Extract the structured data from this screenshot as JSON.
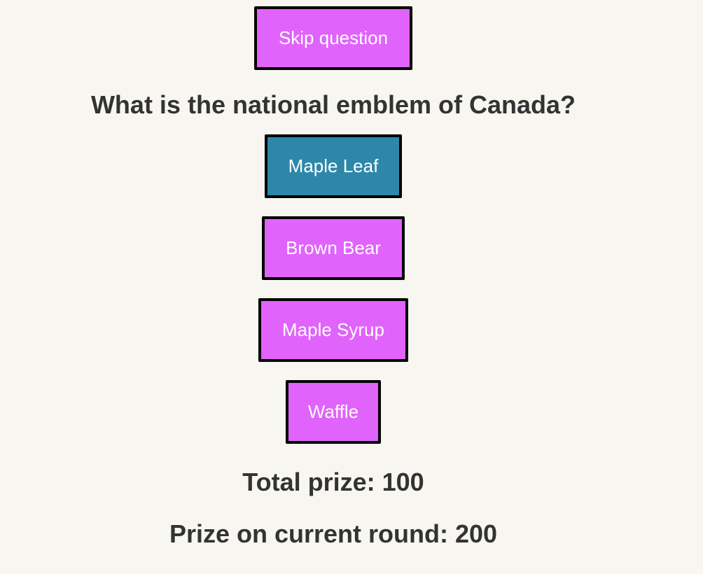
{
  "controls": {
    "skip_label": "Skip question"
  },
  "question": {
    "text": "What is the national emblem of Canada?"
  },
  "answers": [
    {
      "label": "Maple Leaf",
      "selected": true
    },
    {
      "label": "Brown Bear",
      "selected": false
    },
    {
      "label": "Maple Syrup",
      "selected": false
    },
    {
      "label": "Waffle",
      "selected": false
    }
  ],
  "prizes": {
    "total": "Total prize: 100",
    "current_round": "Prize on current round: 200"
  },
  "colors": {
    "background": "#f8f6f1",
    "button": "#e063fb",
    "button_selected": "#2e87a9",
    "text": "#333333"
  }
}
